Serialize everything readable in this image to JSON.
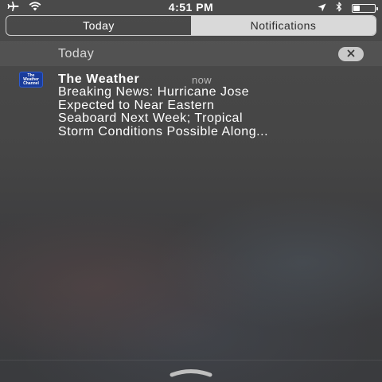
{
  "status_bar": {
    "time": "4:51 PM",
    "left_icons": [
      "airplane-icon",
      "wifi-icon"
    ],
    "right_icons": [
      "location-arrow-icon",
      "bluetooth-icon",
      "battery-icon"
    ]
  },
  "segmented_control": {
    "tabs": [
      {
        "label": "Today",
        "selected": false
      },
      {
        "label": "Notifications",
        "selected": true
      }
    ]
  },
  "section": {
    "title": "Today",
    "clear_icon": "close-icon"
  },
  "notification": {
    "app_name": "The Weather",
    "app_icon_text": "The Weather Channel",
    "time": "now",
    "body": "Breaking News: Hurricane Jose\nExpected to Near Eastern\nSeaboard Next Week; Tropical\nStorm Conditions Possible Along..."
  },
  "footer": {
    "grabber_icon": "chevron-up-icon"
  },
  "colors": {
    "selected_tab_bg": "#d9d9d9",
    "app_icon_bg": "#1a3c9a"
  }
}
